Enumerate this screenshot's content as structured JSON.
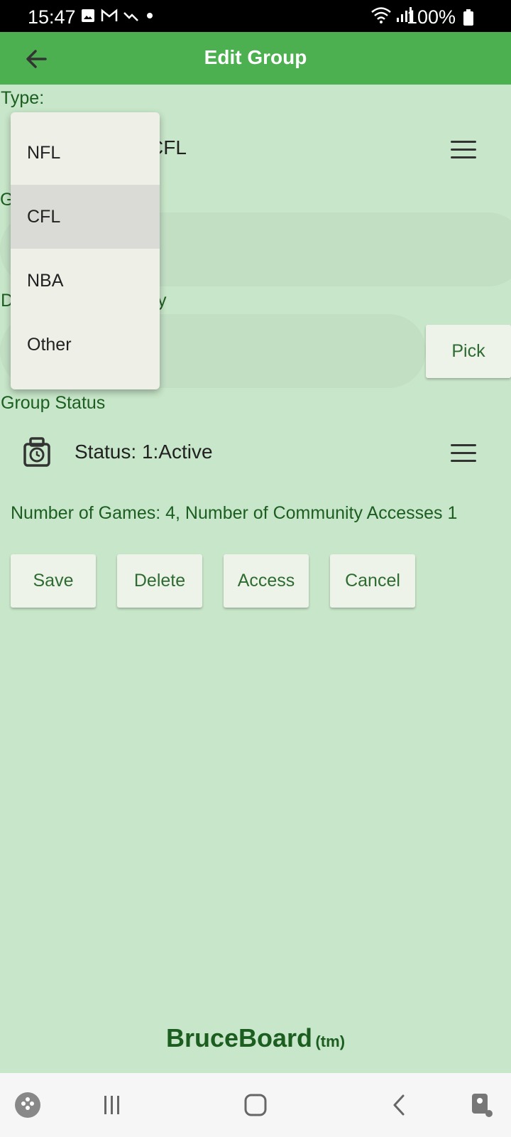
{
  "status_bar": {
    "time": "15:47",
    "battery": "100%",
    "icons_left": [
      "image-icon",
      "gmail-icon",
      "trend-icon",
      "dot-icon"
    ],
    "icons_right": [
      "wifi-icon",
      "signal-icon",
      "battery-icon"
    ]
  },
  "app_bar": {
    "title": "Edit Group",
    "back_icon": "arrow-back-icon"
  },
  "form": {
    "type_label": "Type:",
    "type_value": "CFL",
    "group_label_partial": "G",
    "date_label_partial_left": "D",
    "date_label_partial_right": "y",
    "pick_label": "Pick",
    "status_section_label": "Group Status",
    "status_value": "Status: 1:Active",
    "info_text": "Number of Games: 4, Number of Community Accesses 1"
  },
  "actions": {
    "save": "Save",
    "delete": "Delete",
    "access": "Access",
    "cancel": "Cancel"
  },
  "dropdown": {
    "options": [
      "NFL",
      "CFL",
      "NBA",
      "Other"
    ],
    "selected": "CFL"
  },
  "footer": {
    "brand": "BruceBoard",
    "tm": "(tm)"
  },
  "nav_bar": {
    "items": [
      "game-launcher-icon",
      "recents-icon",
      "home-icon",
      "back-icon",
      "assist-icon"
    ]
  },
  "colors": {
    "app_bar": "#4caf50",
    "background": "#c8e6c9",
    "accent_text": "#1b5e20"
  }
}
